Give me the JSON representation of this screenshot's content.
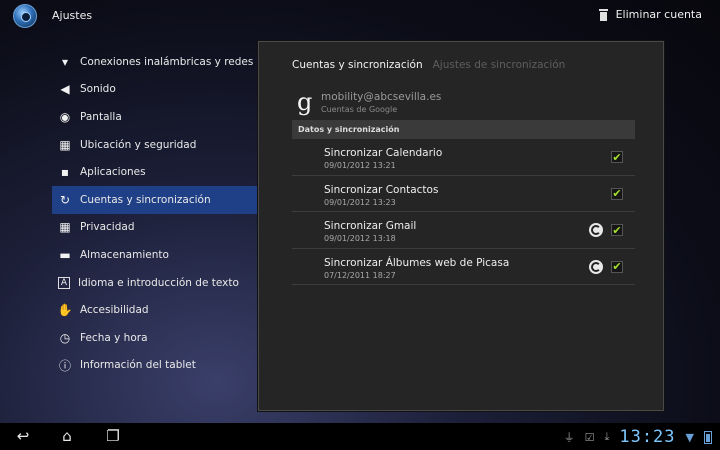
{
  "app": {
    "title": "Ajustes"
  },
  "actions": {
    "delete_account": "Eliminar cuenta"
  },
  "sidebar": {
    "items": [
      {
        "label": "Conexiones inalámbricas y redes",
        "icon": "wifi-icon",
        "active": false
      },
      {
        "label": "Sonido",
        "icon": "speaker-icon",
        "active": false
      },
      {
        "label": "Pantalla",
        "icon": "display-icon",
        "active": false
      },
      {
        "label": "Ubicación y seguridad",
        "icon": "location-grid-icon",
        "active": false
      },
      {
        "label": "Aplicaciones",
        "icon": "apps-icon",
        "active": false
      },
      {
        "label": "Cuentas y sincronización",
        "icon": "sync-arrows-icon",
        "active": true
      },
      {
        "label": "Privacidad",
        "icon": "privacy-grid-icon",
        "active": false
      },
      {
        "label": "Almacenamiento",
        "icon": "storage-icon",
        "active": false
      },
      {
        "label": "Idioma e introducción de texto",
        "icon": "language-a-icon",
        "active": false
      },
      {
        "label": "Accesibilidad",
        "icon": "hand-icon",
        "active": false
      },
      {
        "label": "Fecha y hora",
        "icon": "clock-icon",
        "active": false
      },
      {
        "label": "Información del tablet",
        "icon": "info-icon",
        "active": false
      }
    ]
  },
  "panel": {
    "tabs": [
      {
        "label": "Cuentas y sincronización",
        "active": true
      },
      {
        "label": "Ajustes de sincronización",
        "active": false
      }
    ],
    "account": {
      "email": "mobility@abcsevilla.es",
      "type": "Cuentas de Google"
    },
    "section_header": "Datos y sincronización",
    "sync_items": [
      {
        "title": "Sincronizar Calendario",
        "date": "09/01/2012 13:21",
        "syncing": false,
        "checked": true
      },
      {
        "title": "Sincronizar Contactos",
        "date": "09/01/2012 13:23",
        "syncing": false,
        "checked": true
      },
      {
        "title": "Sincronizar Gmail",
        "date": "09/01/2012 13:18",
        "syncing": true,
        "checked": true
      },
      {
        "title": "Sincronizar Álbumes web de Picasa",
        "date": "07/12/2011 18:27",
        "syncing": true,
        "checked": true
      }
    ]
  },
  "statusbar": {
    "time": "13:23"
  },
  "colors": {
    "active_item": "#1f3f86",
    "check": "#a6e22e",
    "clock": "#7ec8ff"
  }
}
